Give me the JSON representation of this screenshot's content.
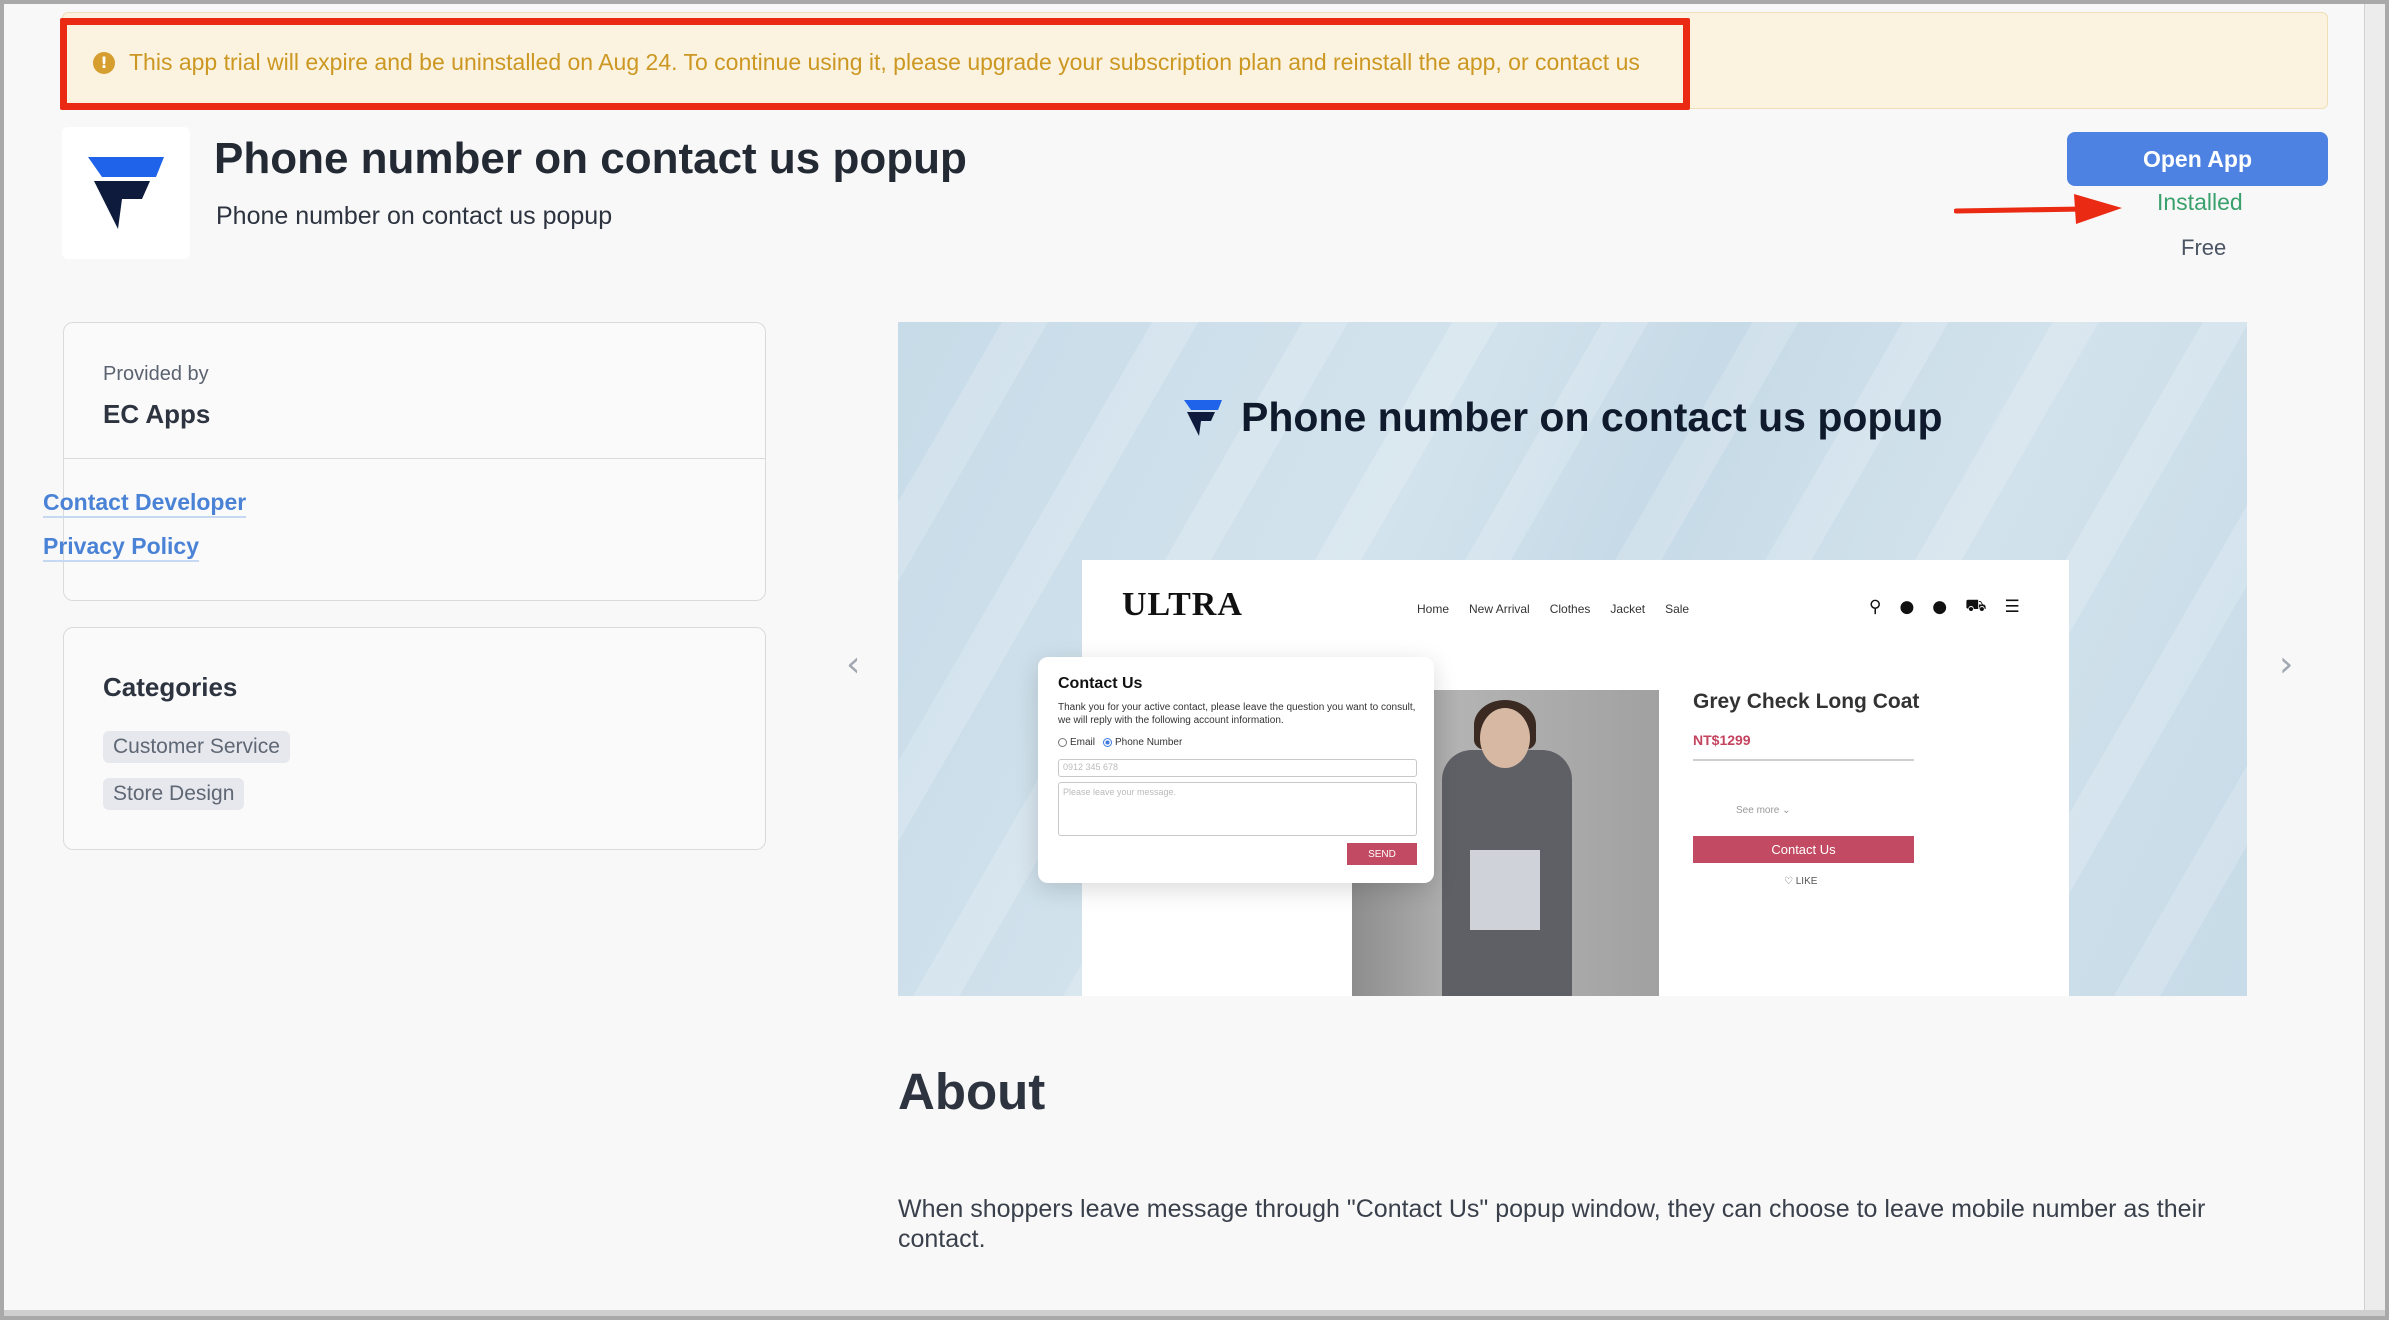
{
  "banner": {
    "icon": "exclamation-circle-icon",
    "icon_glyph": "!",
    "text": "This app trial will expire and be uninstalled on Aug 24. To continue using it, please upgrade your subscription plan and reinstall the app, or contact us",
    "color": "#cc9722"
  },
  "app": {
    "title": "Phone number on contact us popup",
    "subtitle": "Phone number on contact us popup",
    "open_button": "Open App",
    "status": "Installed",
    "price": "Free"
  },
  "provider": {
    "label": "Provided by",
    "name": "EC Apps",
    "links": [
      "Contact Developer",
      "Privacy Policy"
    ]
  },
  "categories": {
    "title": "Categories",
    "tags": [
      "Customer Service",
      "Store Design"
    ]
  },
  "carousel": {
    "slide_title": "Phone number on contact us popup",
    "prev_glyph": "‹",
    "next_glyph": "›",
    "mock": {
      "logo": "ULTRA",
      "nav": [
        "Home",
        "New Arrival",
        "Clothes",
        "Jacket",
        "Sale"
      ],
      "icons": {
        "search": "⚲",
        "chat": "●",
        "user": "●",
        "cart": "⛟",
        "menu": "☰"
      },
      "product_name": "Grey Check Long Coat",
      "product_price": "NT$1299",
      "see_more": "See more ⌄",
      "contact_button": "Contact Us",
      "like": "♡ LIKE",
      "popup": {
        "title": "Contact Us",
        "description": "Thank you for your active contact, please leave the question you want to consult, we will reply with the following account information.",
        "option_email": "Email",
        "option_phone": "Phone Number",
        "phone_placeholder": "0912 345 678",
        "message_placeholder": "Please leave your message.",
        "send": "SEND"
      }
    }
  },
  "about": {
    "title": "About",
    "text": "When shoppers leave message through \"Contact Us\" popup window, they can choose to leave mobile number as their contact."
  },
  "colors": {
    "accent": "#4d82e3",
    "installed": "#3aa06c",
    "annotation": "#ea2a12"
  }
}
